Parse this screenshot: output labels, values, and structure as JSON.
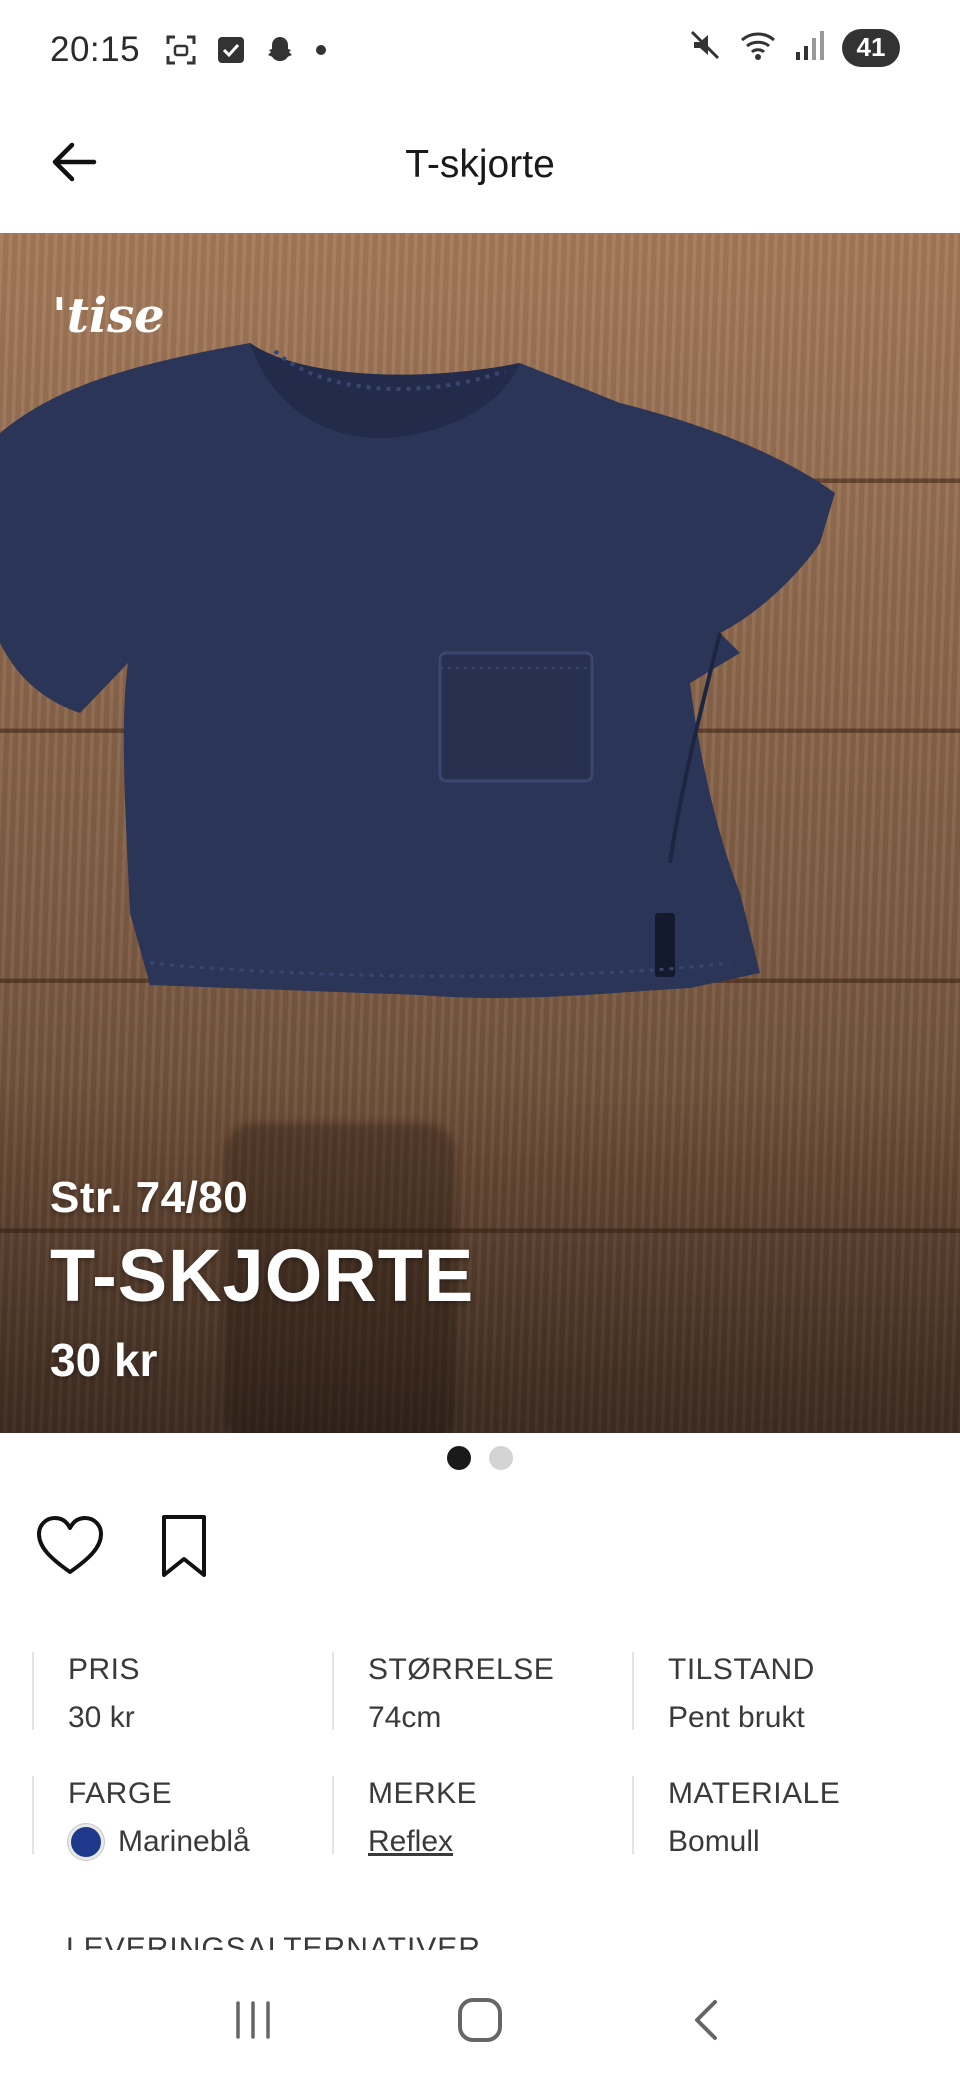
{
  "status_bar": {
    "time": "20:15",
    "battery": "41",
    "icons": [
      "screenshot-icon",
      "checkbox-icon",
      "snapchat-icon",
      "dot-icon",
      "mute-icon",
      "wifi-icon",
      "signal-icon"
    ]
  },
  "header": {
    "title": "T-skjorte",
    "back_icon": "arrow-left-icon"
  },
  "hero": {
    "logo": "'tise",
    "size_text": "Str. 74/80",
    "title": "T-SKJORTE",
    "price": "30 kr"
  },
  "pager": {
    "count": 2,
    "active": 0
  },
  "actions": {
    "like_icon": "heart-icon",
    "save_icon": "bookmark-icon"
  },
  "details": [
    [
      {
        "label": "PRIS",
        "value": "30 kr"
      },
      {
        "label": "STØRRELSE",
        "value": "74cm"
      },
      {
        "label": "TILSTAND",
        "value": "Pent brukt"
      }
    ],
    [
      {
        "label": "FARGE",
        "value": "Marineblå",
        "swatch": "#1f3a8a"
      },
      {
        "label": "MERKE",
        "value": "Reflex"
      },
      {
        "label": "MATERIALE",
        "value": "Bomull"
      }
    ]
  ],
  "next_section": "LEVERINGSALTERNATIVER",
  "colors": {
    "shirt": "#2b3558",
    "swatch": "#1f3a8a",
    "active_dot": "#1a1a1a",
    "inactive_dot": "#d4d4d4"
  },
  "navigation": {
    "recents_icon": "recents-icon",
    "home_icon": "home-icon",
    "back_icon": "back-chevron-icon"
  }
}
